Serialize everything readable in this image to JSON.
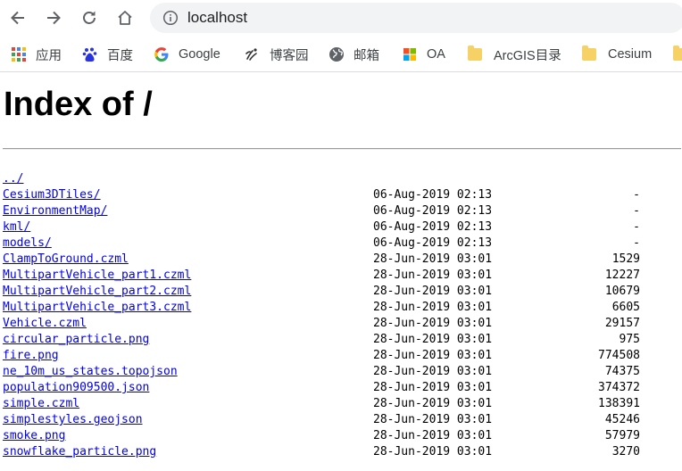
{
  "browser": {
    "url": "localhost"
  },
  "bookmarks": [
    {
      "label": "应用",
      "icon": "apps-grid-icon"
    },
    {
      "label": "百度",
      "icon": "baidu-paw-icon"
    },
    {
      "label": "Google",
      "icon": "google-g-icon"
    },
    {
      "label": "博客园",
      "icon": "cnblogs-icon"
    },
    {
      "label": "邮箱",
      "icon": "globe-icon"
    },
    {
      "label": "OA",
      "icon": "windows-logo-icon"
    },
    {
      "label": "ArcGIS目录",
      "icon": "folder-icon"
    },
    {
      "label": "Cesium",
      "icon": "folder-icon"
    }
  ],
  "page": {
    "heading": "Index of /"
  },
  "entries": [
    {
      "name": "../",
      "date": "",
      "size": ""
    },
    {
      "name": "Cesium3DTiles/",
      "date": "06-Aug-2019 02:13",
      "size": "-"
    },
    {
      "name": "EnvironmentMap/",
      "date": "06-Aug-2019 02:13",
      "size": "-"
    },
    {
      "name": "kml/",
      "date": "06-Aug-2019 02:13",
      "size": "-"
    },
    {
      "name": "models/",
      "date": "06-Aug-2019 02:13",
      "size": "-"
    },
    {
      "name": "ClampToGround.czml",
      "date": "28-Jun-2019 03:01",
      "size": "1529"
    },
    {
      "name": "MultipartVehicle_part1.czml",
      "date": "28-Jun-2019 03:01",
      "size": "12227"
    },
    {
      "name": "MultipartVehicle_part2.czml",
      "date": "28-Jun-2019 03:01",
      "size": "10679"
    },
    {
      "name": "MultipartVehicle_part3.czml",
      "date": "28-Jun-2019 03:01",
      "size": "6605"
    },
    {
      "name": "Vehicle.czml",
      "date": "28-Jun-2019 03:01",
      "size": "29157"
    },
    {
      "name": "circular_particle.png",
      "date": "28-Jun-2019 03:01",
      "size": "975"
    },
    {
      "name": "fire.png",
      "date": "28-Jun-2019 03:01",
      "size": "774508"
    },
    {
      "name": "ne_10m_us_states.topojson",
      "date": "28-Jun-2019 03:01",
      "size": "74375"
    },
    {
      "name": "population909500.json",
      "date": "28-Jun-2019 03:01",
      "size": "374372"
    },
    {
      "name": "simple.czml",
      "date": "28-Jun-2019 03:01",
      "size": "138391"
    },
    {
      "name": "simplestyles.geojson",
      "date": "28-Jun-2019 03:01",
      "size": "45246"
    },
    {
      "name": "smoke.png",
      "date": "28-Jun-2019 03:01",
      "size": "57979"
    },
    {
      "name": "snowflake_particle.png",
      "date": "28-Jun-2019 03:01",
      "size": "3270"
    }
  ],
  "colors": {
    "link": "#0000ee",
    "omnibox_bg": "#f1f3f4",
    "folder": "#f6d266"
  }
}
